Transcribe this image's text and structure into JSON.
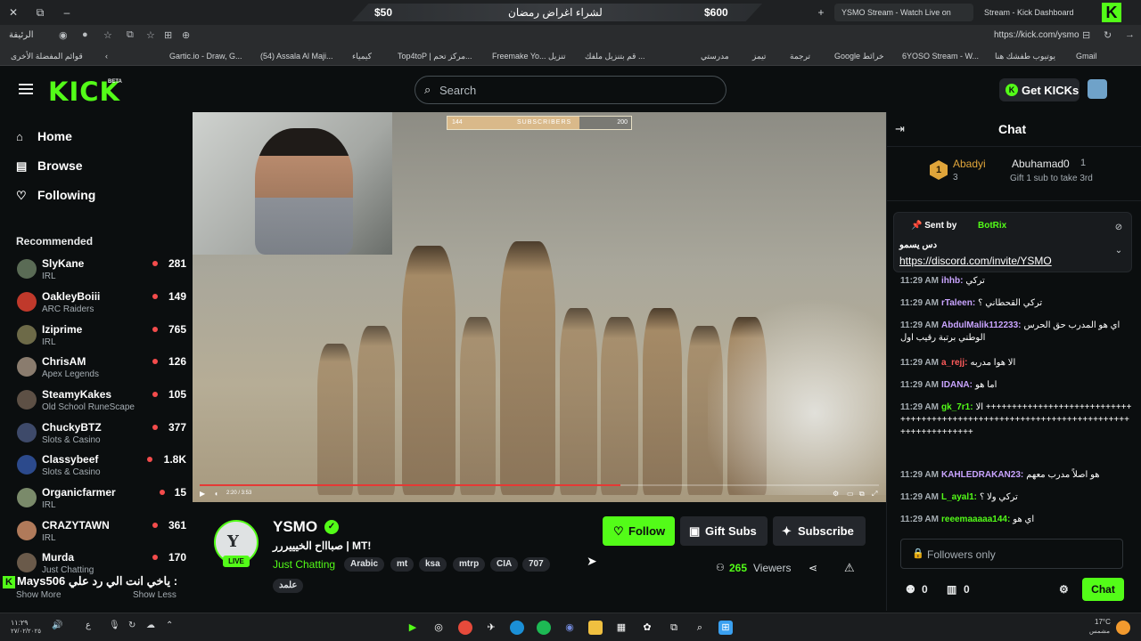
{
  "browser": {
    "ad_price_left": "$50",
    "ad_text": "لشراء اغراض رمضان",
    "ad_price_right": "$600",
    "tabs": [
      {
        "label": "YSMO Stream - Watch Live on"
      },
      {
        "label": "Stream - Kick Dashboard"
      }
    ],
    "url": "https://kick.com/ysmo",
    "home_label": "الرئيفة",
    "bookmarks": [
      "قوائم المفضلة الأخرى",
      "Gartic.io - Draw, G...",
      "(54) Assala Al Maji...",
      "كيمياء",
      "Top4toP | مركز تحم...",
      "Freemake Yo... تنزيل",
      "قم بتنزيل ملفك ...",
      "مدرستي",
      "تيمز",
      "ترجمة",
      "Google خرائط",
      "6YOSO Stream - W...",
      "يوتيوب طفشك هنا",
      "Gmail"
    ]
  },
  "header": {
    "logo": "KICK",
    "beta": "BETA",
    "search_placeholder": "Search",
    "get_kicks": "Get KICKs",
    "kicks_coin": "K"
  },
  "sidebar": {
    "nav": [
      {
        "label": "Home",
        "icon": "home-icon"
      },
      {
        "label": "Browse",
        "icon": "browse-icon"
      },
      {
        "label": "Following",
        "icon": "heart-icon"
      }
    ],
    "recommended_title": "Recommended",
    "channels": [
      {
        "name": "SlyKane",
        "category": "IRL",
        "viewers": "281"
      },
      {
        "name": "OakleyBoiii",
        "category": "ARC Raiders",
        "viewers": "149"
      },
      {
        "name": "Iziprime",
        "category": "IRL",
        "viewers": "765"
      },
      {
        "name": "ChrisAM",
        "category": "Apex Legends",
        "viewers": "126"
      },
      {
        "name": "SteamyKakes",
        "category": "Old School RuneScape",
        "viewers": "105"
      },
      {
        "name": "ChuckyBTZ",
        "category": "Slots & Casino",
        "viewers": "377"
      },
      {
        "name": "Classybeef",
        "category": "Slots & Casino",
        "viewers": "1.8K"
      },
      {
        "name": "Organicfarmer",
        "category": "IRL",
        "viewers": "15"
      },
      {
        "name": "CRAZYTAWN",
        "category": "IRL",
        "viewers": "361"
      },
      {
        "name": "Murda",
        "category": "Just Chatting",
        "viewers": "170"
      }
    ],
    "show_more": "Show More",
    "show_less": "Show Less",
    "overlay_user": "Mays506",
    "overlay_text": "ياخي انت الي رد علي :"
  },
  "video": {
    "sub_goal_current": "144",
    "sub_goal_label": "SUBSCRIBERS",
    "sub_goal_target": "200",
    "sub_goal_progress": 0.72,
    "playback_progress": 0.62,
    "time": "2:20 / 3:53"
  },
  "stream": {
    "avatar_letter": "Y",
    "live": "LIVE",
    "streamer": "YSMO",
    "title": "صباااح الخيييررر | MT!",
    "category": "Just Chatting",
    "tags": [
      "Arabic",
      "mt",
      "ksa",
      "mtrp",
      "CIA",
      "707",
      "علمد"
    ],
    "follow": "Follow",
    "gift_subs": "Gift Subs",
    "subscribe": "Subscribe",
    "viewers": "265",
    "viewers_label": "Viewers"
  },
  "chat": {
    "title": "Chat",
    "top_gifter_rank": "1",
    "top_gifter": "Abadyi",
    "top_gifter_count": "3",
    "second_gifter": "Abuhamad0",
    "second_gifter_count": "1",
    "gift_hint": "Gift 1 sub to take 3rd",
    "pinned_sentby": "Sent by",
    "pinned_bot": "BotRix",
    "pinned_text": "دس يسمو",
    "pinned_link": "https://discord.com/invite/YSMO",
    "messages": [
      {
        "time": "11:29 AM",
        "user": "ihhb:",
        "text": "تركي",
        "color": "#c9a4ff"
      },
      {
        "time": "11:29 AM",
        "user": "rTaleen:",
        "text": "تركي القحطاني ؟",
        "color": "#c9a4ff"
      },
      {
        "time": "11:29 AM",
        "user": "AbdulMalik112233:",
        "text": "اي هو المدرب حق الحرس الوطني برتبة رقيب اول",
        "color": "#c9a4ff"
      },
      {
        "time": "11:29 AM",
        "user": "a_rejj:",
        "text": "الا هوا مدربه",
        "color": "#ff5b5b"
      },
      {
        "time": "11:29 AM",
        "user": "IDANA:",
        "text": "اما هو",
        "color": "#c9a4ff"
      },
      {
        "time": "11:29 AM",
        "user": "gk_7r1:",
        "text": "الا ++++++++++++++++++++++++++++++++++++++++++++++++++++++++++++++++++++++++++++++++++++++",
        "color": "#53fc18"
      },
      {
        "time": "11:29 AM",
        "user": "KAHLEDRAKAN23:",
        "text": "هو اصلاً مدرب معهم",
        "color": "#c9a4ff"
      },
      {
        "time": "11:29 AM",
        "user": "L_ayal1:",
        "text": "تركي ولا ؟",
        "color": "#53fc18"
      },
      {
        "time": "11:29 AM",
        "user": "reeemaaaaa144:",
        "text": "اي هو",
        "color": "#53fc18"
      }
    ],
    "input_placeholder": "Followers only",
    "footer_left_count": "0",
    "footer_mid_count": "0",
    "send": "Chat"
  },
  "taskbar": {
    "time": "١١:٢٩",
    "date": "٢٧/٠٢/٢٠٢٥",
    "lang": "ع",
    "weather": "17°C",
    "weather_label": "مشمس"
  }
}
